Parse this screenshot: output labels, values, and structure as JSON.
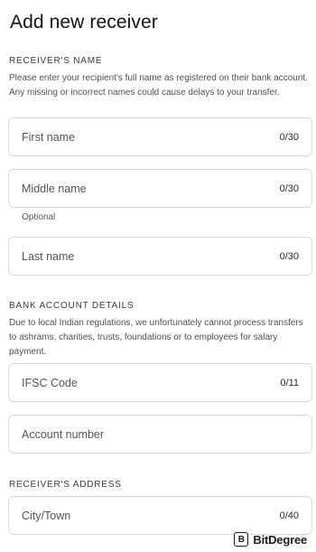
{
  "page": {
    "title": "Add new receiver"
  },
  "receiver_name": {
    "heading": "RECEIVER'S NAME",
    "description": "Please enter your recipient's full name as registered on their bank account. Any missing or incorrect names could cause delays to your transfer.",
    "first_name": {
      "placeholder": "First name",
      "value": "",
      "counter": "0/30"
    },
    "middle_name": {
      "placeholder": "Middle name",
      "value": "",
      "counter": "0/30",
      "helper": "Optional"
    },
    "last_name": {
      "placeholder": "Last name",
      "value": "",
      "counter": "0/30"
    }
  },
  "bank_account": {
    "heading": "BANK ACCOUNT DETAILS",
    "description": "Due to local Indian regulations, we unfortunately cannot process transfers to ashrams, charities, trusts, foundations or to employees for salary payment.",
    "ifsc": {
      "placeholder": "IFSC Code",
      "value": "",
      "counter": "0/11"
    },
    "account_number": {
      "placeholder": "Account number",
      "value": ""
    }
  },
  "receiver_address": {
    "heading": "RECEIVER'S ADDRESS",
    "city": {
      "placeholder": "City/Town",
      "value": "",
      "counter": "0/40"
    }
  },
  "watermark": {
    "logo_letter": "B",
    "text": "BitDegree"
  }
}
